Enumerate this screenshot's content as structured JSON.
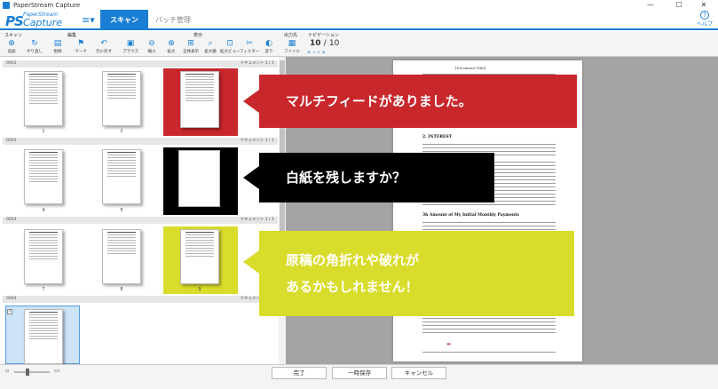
{
  "window": {
    "title": "PaperStream Capture",
    "min": "—",
    "max": "☐",
    "close": "✕"
  },
  "header": {
    "logo_brand": "PaperStream",
    "logo_name": "Capture",
    "tabs": [
      {
        "label": "スキャン"
      },
      {
        "label": "バッチ管理"
      }
    ],
    "help_label": "ヘルプ"
  },
  "toolbar": {
    "groups": {
      "scan": "スキャン",
      "edit": "編集",
      "view": "表示",
      "output": "出力先",
      "navigation": "ナビゲーション"
    },
    "buttons": [
      "追加",
      "やり直し",
      "削除",
      "マーク",
      "元に戻す",
      "ブラウズ",
      "縮小",
      "拡大",
      "全体表示",
      "拡大鏡",
      "拡大ビュー",
      "フィルター",
      "塗り",
      "ファイル"
    ],
    "page_current": "10",
    "page_sep": "/",
    "page_total": "10"
  },
  "thumbnails": {
    "rows": [
      {
        "num": "0001",
        "label": "ドキュメント 1 / 1"
      },
      {
        "num": "0002",
        "label": "ドキュメント 1 / 1"
      },
      {
        "num": "0003",
        "label": "ドキュメント 1 / 1"
      },
      {
        "num": "0004",
        "label": "ドキュメント 1 / 1"
      }
    ],
    "page_numbers": [
      "1",
      "2",
      "3",
      "4",
      "5",
      "6",
      "7",
      "8",
      "9"
    ]
  },
  "document": {
    "title": "[Document Title]",
    "heading1": "2. INTEREST",
    "heading2": "3b Amount of My Initial Monthly Payments"
  },
  "callouts": {
    "multifeed": "マルチフィードがありました。",
    "blank": "白紙を残しますか？",
    "fold_line1": "原稿の角折れや破れが",
    "fold_line2": "あるかもしれません！"
  },
  "footer": {
    "complete": "完了",
    "pause": "一時保存",
    "cancel": "キャンセル"
  },
  "colors": {
    "accent": "#1a7fd4",
    "red": "#c8272c",
    "yellow": "#d8dc2a",
    "black": "#000000"
  }
}
